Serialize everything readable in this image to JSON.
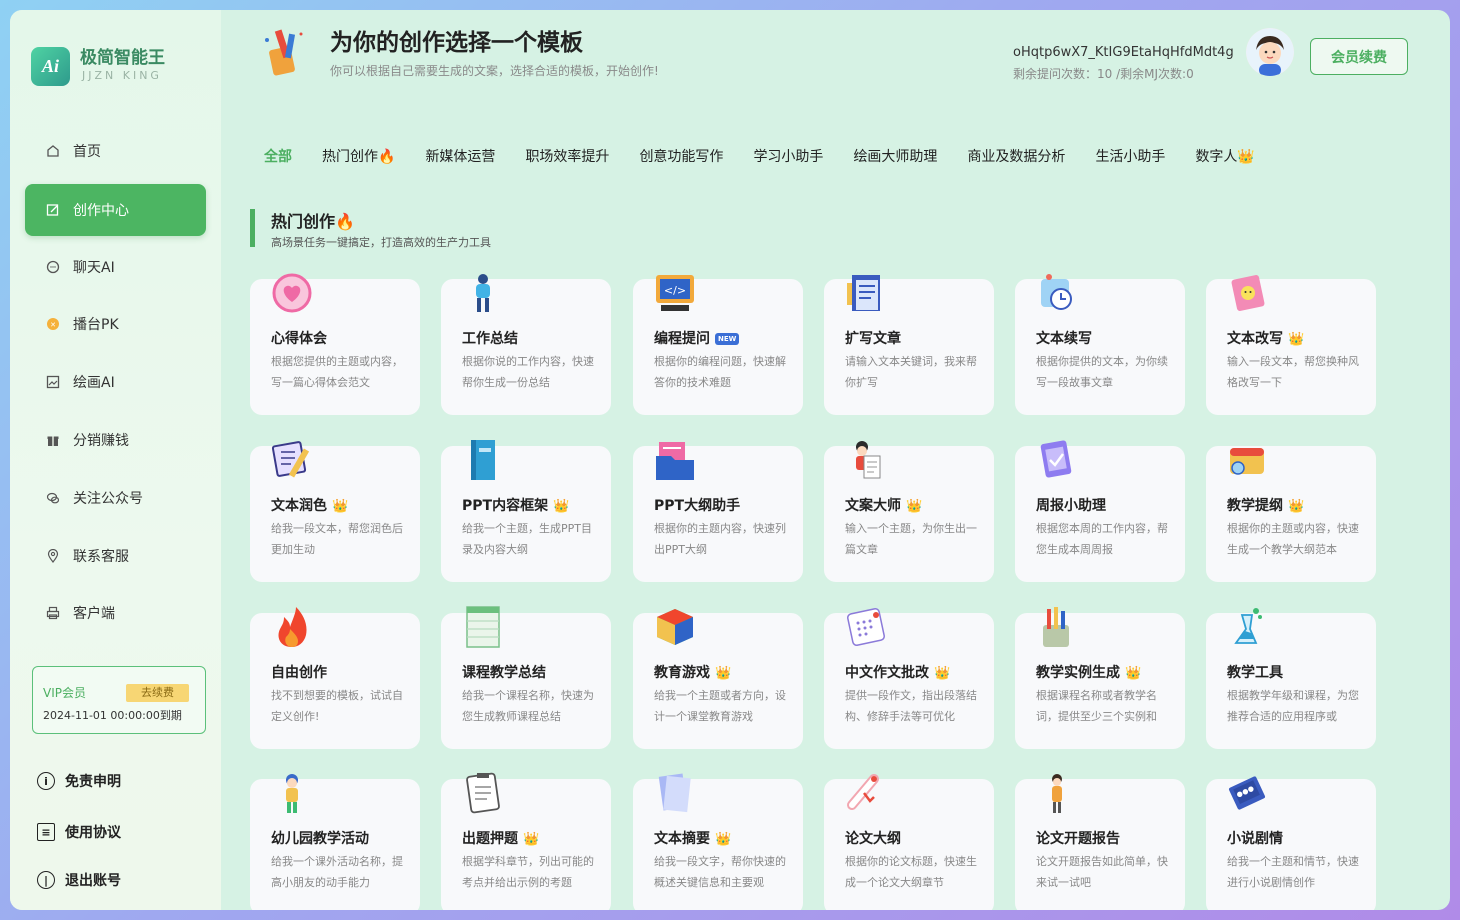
{
  "brand": {
    "name": "极简智能王",
    "sub": "JJZN KING",
    "logo_text": "Ai"
  },
  "nav": [
    {
      "label": "首页",
      "icon": "home-icon"
    },
    {
      "label": "创作中心",
      "icon": "edit-icon"
    },
    {
      "label": "聊天AI",
      "icon": "chat-icon"
    },
    {
      "label": "播台PK",
      "icon": "pk-icon"
    },
    {
      "label": "绘画AI",
      "icon": "image-icon"
    },
    {
      "label": "分销赚钱",
      "icon": "gift-icon"
    },
    {
      "label": "关注公众号",
      "icon": "wechat-icon"
    },
    {
      "label": "联系客服",
      "icon": "location-icon"
    },
    {
      "label": "客户端",
      "icon": "printer-icon"
    }
  ],
  "vip": {
    "title": "VIP会员",
    "renew": "去续费",
    "expire": "2024-11-01 00:00:00到期"
  },
  "bottom": [
    {
      "label": "免责申明",
      "icon": "info-icon"
    },
    {
      "label": "使用协议",
      "icon": "document-icon"
    },
    {
      "label": "退出账号",
      "icon": "power-icon"
    }
  ],
  "header": {
    "title": "为你的创作选择一个模板",
    "subtitle": "你可以根据自己需要生成的文案，选择合适的模板，开始创作!",
    "user_name": "oHqtp6wX7_KtIG9EtaHqHfdMdt4g",
    "quota": "剩余提问次数：10 /剩余MJ次数:0",
    "renew_button": "会员续费"
  },
  "tabs": [
    "全部",
    "热门创作🔥",
    "新媒体运营",
    "职场效率提升",
    "创意功能写作",
    "学习小助手",
    "绘画大师助理",
    "商业及数据分析",
    "生活小助手",
    "数字人👑"
  ],
  "section": {
    "title": "热门创作🔥",
    "subtitle": "高场景任务一键搞定，打造高效的生产力工具"
  },
  "cards": [
    {
      "title": "心得体会",
      "badge": "",
      "desc": "根据您提供的主题或内容，写一篇心得体会范文",
      "icon": "heart-icon"
    },
    {
      "title": "工作总结",
      "badge": "",
      "desc": "根据你说的工作内容，快速帮你生成一份总结",
      "icon": "person-icon"
    },
    {
      "title": "编程提问",
      "badge": "NEW",
      "desc": "根据你的编程问题，快速解答你的技术难题",
      "icon": "code-icon"
    },
    {
      "title": "扩写文章",
      "badge": "",
      "desc": "请输入文本关键词，我来帮你扩写",
      "icon": "article-icon"
    },
    {
      "title": "文本续写",
      "badge": "",
      "desc": "根据你提供的文本，为你续写一段故事文章",
      "icon": "clock-icon"
    },
    {
      "title": "文本改写",
      "badge": "👑",
      "desc": "输入一段文本，帮您换种风格改写一下",
      "icon": "notebook-icon"
    },
    {
      "title": "文本润色",
      "badge": "👑",
      "desc": "给我一段文本，帮您润色后更加生动",
      "icon": "pencil-icon"
    },
    {
      "title": "PPT内容框架",
      "badge": "👑",
      "desc": "给我一个主题，生成PPT目录及内容大纲",
      "icon": "book-icon"
    },
    {
      "title": "PPT大纲助手",
      "badge": "",
      "desc": "根据你的主题内容，快速列出PPT大纲",
      "icon": "folder-icon"
    },
    {
      "title": "文案大师",
      "badge": "👑",
      "desc": "输入一个主题，为你生出一篇文章",
      "icon": "writer-icon"
    },
    {
      "title": "周报小助理",
      "badge": "",
      "desc": "根据您本周的工作内容，帮您生成本周周报",
      "icon": "report-icon"
    },
    {
      "title": "教学提纲",
      "badge": "👑",
      "desc": "根据你的主题或内容，快速生成一个教学大纲范本",
      "icon": "teaching-icon"
    },
    {
      "title": "自由创作",
      "badge": "",
      "desc": "找不到想要的模板，试试自定义创作!",
      "icon": "fire-icon"
    },
    {
      "title": "课程教学总结",
      "badge": "",
      "desc": "给我一个课程名称，快速为您生成教师课程总结",
      "icon": "sheet-icon"
    },
    {
      "title": "教育游戏",
      "badge": "👑",
      "desc": "给我一个主题或者方向，设计一个课堂教育游戏",
      "icon": "cube-icon"
    },
    {
      "title": "中文作文批改",
      "badge": "👑",
      "desc": "提供一段作文，指出段落结构、修辞手法等可优化",
      "icon": "calendar-icon"
    },
    {
      "title": "教学实例生成",
      "badge": "👑",
      "desc": "根据课程名称或者教学名词，提供至少三个实例和",
      "icon": "pencils-icon"
    },
    {
      "title": "教学工具",
      "badge": "",
      "desc": "根据教学年级和课程，为您推荐合适的应用程序或",
      "icon": "flask-icon"
    },
    {
      "title": "幼儿园教学活动",
      "badge": "",
      "desc": "给我一个课外活动名称，提高小朋友的动手能力",
      "icon": "kid-icon"
    },
    {
      "title": "出题押题",
      "badge": "👑",
      "desc": "根据学科章节，列出可能的考点并给出示例的考题",
      "icon": "clipboard-icon"
    },
    {
      "title": "文本摘要",
      "badge": "👑",
      "desc": "给我一段文字，帮你快速的概述关键信息和主要观",
      "icon": "papers-icon"
    },
    {
      "title": "论文大纲",
      "badge": "",
      "desc": "根据你的论文标题，快速生成一个论文大纲章节",
      "icon": "scroll-icon"
    },
    {
      "title": "论文开题报告",
      "badge": "",
      "desc": "论文开题报告如此简单，快来试一试吧",
      "icon": "student-icon"
    },
    {
      "title": "小说剧情",
      "badge": "",
      "desc": "给我一个主题和情节，快速进行小说剧情创作",
      "icon": "novel-icon"
    }
  ],
  "colors": {
    "accent": "#4caf61",
    "bg": "#d6f2e4",
    "card": "#f8f9fb"
  }
}
